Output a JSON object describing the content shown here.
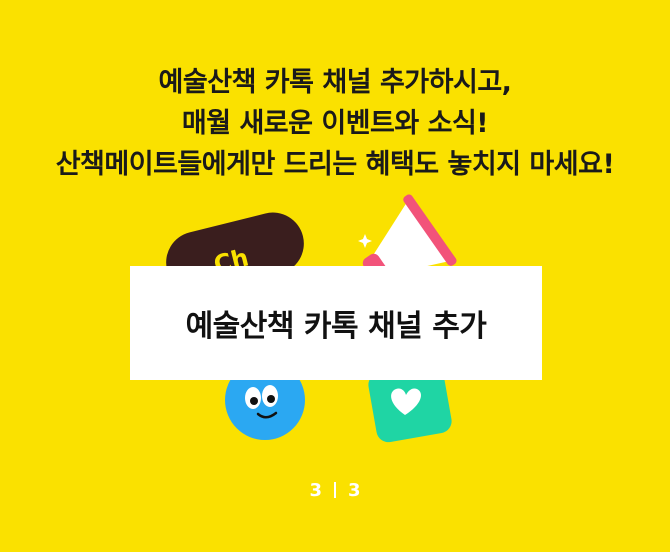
{
  "headline": {
    "line1": "예술산책 카톡 채널 추가하시고,",
    "line2": "매월 새로운 이벤트와 소식!",
    "line3": "산책메이트들에게만 드리는 혜택도 놓치지 마세요!"
  },
  "cta": {
    "label": "예술산책 카톡 채널 추가"
  },
  "pager": {
    "current": "3",
    "total": "3"
  },
  "icons": [
    "chat-channel-badge-icon",
    "megaphone-icon",
    "smiley-face-icon",
    "heart-card-icon",
    "sparkle-icon"
  ],
  "colors": {
    "background": "#FAE100",
    "button": "#FFFFFF",
    "badge": "#3A1E1E",
    "megaphone_pink": "#F2537A",
    "face_blue": "#2BA8F2",
    "heart_green": "#1FD5A4"
  }
}
